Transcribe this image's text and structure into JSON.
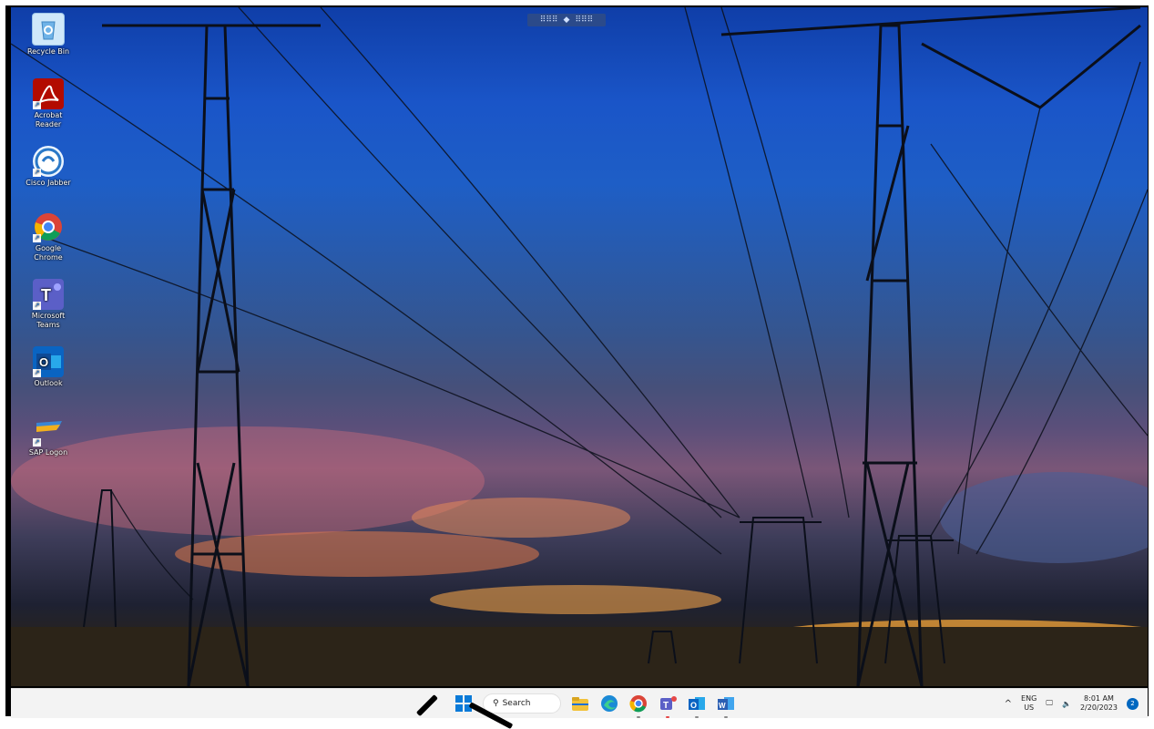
{
  "desktop": {
    "remote_bar": {
      "left_grip": "⠿⠿⠿",
      "center_icon": "◆",
      "right_grip": "⠿⠿⠿"
    },
    "icons": [
      {
        "label": "Recycle Bin",
        "icon": "recycle-bin-icon",
        "color": "#6fb3e8"
      },
      {
        "label": "Acrobat Reader",
        "icon": "acrobat-reader-icon",
        "color": "#b30b00"
      },
      {
        "label": "Cisco Jabber",
        "icon": "cisco-jabber-icon",
        "color": "#2a78c7"
      },
      {
        "label": "Google Chrome",
        "icon": "chrome-icon",
        "color": "#4285f4"
      },
      {
        "label": "Microsoft Teams",
        "icon": "teams-icon",
        "color": "#5b5fc7"
      },
      {
        "label": "Outlook",
        "icon": "outlook-icon",
        "color": "#0a64c2"
      },
      {
        "label": "SAP Logon",
        "icon": "sap-logon-icon",
        "color": "#3a86d4"
      }
    ]
  },
  "taskbar": {
    "search_label": "Search",
    "apps": [
      {
        "name": "file-explorer-icon",
        "color": "#f2c23a"
      },
      {
        "name": "edge-icon",
        "color": "#1b8ad6"
      },
      {
        "name": "chrome-icon",
        "color": "#e54234"
      },
      {
        "name": "teams-icon",
        "color": "#5b5fc7"
      },
      {
        "name": "outlook-icon",
        "color": "#0a64c2"
      },
      {
        "name": "word-icon",
        "color": "#2b5fb3"
      }
    ],
    "tray": {
      "chevron": "^",
      "lang_top": "ENG",
      "lang_bottom": "US",
      "time": "8:01 AM",
      "date": "2/20/2023",
      "notification_count": "2"
    }
  }
}
